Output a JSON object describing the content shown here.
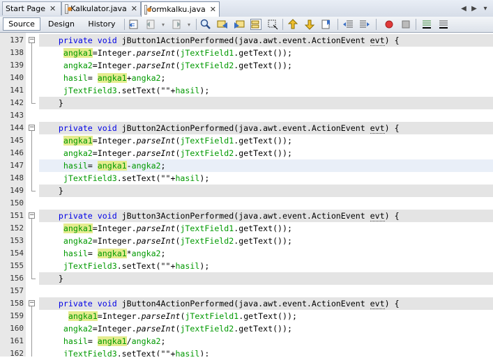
{
  "tabs": [
    {
      "label": "Start Page",
      "close": "✕",
      "active": false
    },
    {
      "label": "Kalkulator.java",
      "close": "✕",
      "active": false
    },
    {
      "label": "formkalku.java",
      "close": "✕",
      "active": true
    }
  ],
  "tab_nav": {
    "left": "◀",
    "right": "▶",
    "menu": "▾"
  },
  "view_tabs": [
    "Source",
    "Design",
    "History"
  ],
  "toolbar_icons": [
    "last-edit-icon",
    "back-icon",
    "forward-icon",
    "find-icon",
    "find-previous-icon",
    "find-next-icon",
    "toggle-highlight-icon",
    "toggle-rect-select-icon",
    "previous-bookmark-icon",
    "next-bookmark-icon",
    "toggle-bookmark-icon",
    "shift-left-icon",
    "shift-right-icon",
    "record-macro-icon",
    "stop-macro-icon",
    "comment-icon"
  ],
  "lines": [
    {
      "n": "137",
      "marker": "fold-open",
      "bg": "method",
      "parts": [
        {
          "t": "    "
        },
        {
          "t": "private",
          "c": "kw"
        },
        {
          "t": " "
        },
        {
          "t": "void",
          "c": "kw"
        },
        {
          "t": " jButton1ActionPerformed(java.awt.event.ActionEvent "
        },
        {
          "t": "evt",
          "c": "sq"
        },
        {
          "t": ") {"
        }
      ]
    },
    {
      "n": "138",
      "marker": "",
      "bg": "",
      "parts": [
        {
          "t": "     "
        },
        {
          "t": "angka1",
          "c": "fld hl"
        },
        {
          "t": "=Integer."
        },
        {
          "t": "parseInt",
          "c": "it"
        },
        {
          "t": "("
        },
        {
          "t": "jTextField1",
          "c": "fld"
        },
        {
          "t": ".getText());"
        }
      ]
    },
    {
      "n": "139",
      "marker": "",
      "bg": "",
      "parts": [
        {
          "t": "     "
        },
        {
          "t": "angka2",
          "c": "fld"
        },
        {
          "t": "=Integer."
        },
        {
          "t": "parseInt",
          "c": "it"
        },
        {
          "t": "("
        },
        {
          "t": "jTextField2",
          "c": "fld"
        },
        {
          "t": ".getText());"
        }
      ]
    },
    {
      "n": "140",
      "marker": "",
      "bg": "",
      "parts": [
        {
          "t": "     "
        },
        {
          "t": "hasil",
          "c": "fld"
        },
        {
          "t": "= "
        },
        {
          "t": "angka1",
          "c": "fld hl"
        },
        {
          "t": "+"
        },
        {
          "t": "angka2",
          "c": "fld"
        },
        {
          "t": ";"
        }
      ]
    },
    {
      "n": "141",
      "marker": "",
      "bg": "",
      "parts": [
        {
          "t": "     "
        },
        {
          "t": "jTextField3",
          "c": "fld"
        },
        {
          "t": ".setText(\"\"+"
        },
        {
          "t": "hasil",
          "c": "fld"
        },
        {
          "t": ");"
        }
      ]
    },
    {
      "n": "142",
      "marker": "fold-end",
      "bg": "method",
      "parts": [
        {
          "t": "    }"
        }
      ]
    },
    {
      "n": "143",
      "marker": "",
      "bg": "",
      "parts": [
        {
          "t": ""
        }
      ]
    },
    {
      "n": "144",
      "marker": "fold-open",
      "bg": "method",
      "parts": [
        {
          "t": "    "
        },
        {
          "t": "private",
          "c": "kw"
        },
        {
          "t": " "
        },
        {
          "t": "void",
          "c": "kw"
        },
        {
          "t": " jButton2ActionPerformed(java.awt.event.ActionEvent "
        },
        {
          "t": "evt",
          "c": "sq"
        },
        {
          "t": ") {"
        }
      ]
    },
    {
      "n": "145",
      "marker": "",
      "bg": "",
      "parts": [
        {
          "t": "     "
        },
        {
          "t": "angka1",
          "c": "fld hl"
        },
        {
          "t": "=Integer."
        },
        {
          "t": "parseInt",
          "c": "it"
        },
        {
          "t": "("
        },
        {
          "t": "jTextField1",
          "c": "fld"
        },
        {
          "t": ".getText());"
        }
      ]
    },
    {
      "n": "146",
      "marker": "",
      "bg": "",
      "parts": [
        {
          "t": "     "
        },
        {
          "t": "angka2",
          "c": "fld"
        },
        {
          "t": "=Integer."
        },
        {
          "t": "parseInt",
          "c": "it"
        },
        {
          "t": "("
        },
        {
          "t": "jTextField2",
          "c": "fld"
        },
        {
          "t": ".getText());"
        }
      ]
    },
    {
      "n": "147",
      "marker": "",
      "bg": "current",
      "parts": [
        {
          "t": "     "
        },
        {
          "t": "hasil",
          "c": "fld"
        },
        {
          "t": "= "
        },
        {
          "t": "angka1",
          "c": "fld hl"
        },
        {
          "t": "-"
        },
        {
          "t": "angka2",
          "c": "fld"
        },
        {
          "t": ";"
        }
      ]
    },
    {
      "n": "148",
      "marker": "",
      "bg": "",
      "parts": [
        {
          "t": "     "
        },
        {
          "t": "jTextField3",
          "c": "fld"
        },
        {
          "t": ".setText(\"\"+"
        },
        {
          "t": "hasil",
          "c": "fld"
        },
        {
          "t": ");"
        }
      ]
    },
    {
      "n": "149",
      "marker": "fold-end",
      "bg": "method",
      "parts": [
        {
          "t": "    }"
        }
      ]
    },
    {
      "n": "150",
      "marker": "",
      "bg": "",
      "parts": [
        {
          "t": ""
        }
      ]
    },
    {
      "n": "151",
      "marker": "fold-open",
      "bg": "method",
      "parts": [
        {
          "t": "    "
        },
        {
          "t": "private",
          "c": "kw"
        },
        {
          "t": " "
        },
        {
          "t": "void",
          "c": "kw"
        },
        {
          "t": " jButton3ActionPerformed(java.awt.event.ActionEvent "
        },
        {
          "t": "evt",
          "c": "sq"
        },
        {
          "t": ") {"
        }
      ]
    },
    {
      "n": "152",
      "marker": "",
      "bg": "",
      "parts": [
        {
          "t": "     "
        },
        {
          "t": "angka1",
          "c": "fld hl"
        },
        {
          "t": "=Integer."
        },
        {
          "t": "parseInt",
          "c": "it"
        },
        {
          "t": "("
        },
        {
          "t": "jTextField1",
          "c": "fld"
        },
        {
          "t": ".getText());"
        }
      ]
    },
    {
      "n": "153",
      "marker": "",
      "bg": "",
      "parts": [
        {
          "t": "     "
        },
        {
          "t": "angka2",
          "c": "fld"
        },
        {
          "t": "=Integer."
        },
        {
          "t": "parseInt",
          "c": "it"
        },
        {
          "t": "("
        },
        {
          "t": "jTextField2",
          "c": "fld"
        },
        {
          "t": ".getText());"
        }
      ]
    },
    {
      "n": "154",
      "marker": "",
      "bg": "",
      "parts": [
        {
          "t": "     "
        },
        {
          "t": "hasil",
          "c": "fld"
        },
        {
          "t": "= "
        },
        {
          "t": "angka1",
          "c": "fld hl"
        },
        {
          "t": "*"
        },
        {
          "t": "angka2",
          "c": "fld"
        },
        {
          "t": ";"
        }
      ]
    },
    {
      "n": "155",
      "marker": "",
      "bg": "",
      "parts": [
        {
          "t": "     "
        },
        {
          "t": "jTextField3",
          "c": "fld"
        },
        {
          "t": ".setText(\"\"+"
        },
        {
          "t": "hasil",
          "c": "fld"
        },
        {
          "t": ");"
        }
      ]
    },
    {
      "n": "156",
      "marker": "fold-end",
      "bg": "method",
      "parts": [
        {
          "t": "    }"
        }
      ]
    },
    {
      "n": "157",
      "marker": "",
      "bg": "",
      "parts": [
        {
          "t": ""
        }
      ]
    },
    {
      "n": "158",
      "marker": "fold-open",
      "bg": "method",
      "parts": [
        {
          "t": "    "
        },
        {
          "t": "private",
          "c": "kw"
        },
        {
          "t": " "
        },
        {
          "t": "void",
          "c": "kw"
        },
        {
          "t": " jButton4ActionPerformed(java.awt.event.ActionEvent "
        },
        {
          "t": "evt",
          "c": "sq"
        },
        {
          "t": ") {"
        }
      ]
    },
    {
      "n": "159",
      "marker": "",
      "bg": "",
      "parts": [
        {
          "t": "      "
        },
        {
          "t": "angka1",
          "c": "fld hl"
        },
        {
          "t": "=Integer."
        },
        {
          "t": "parseInt",
          "c": "it"
        },
        {
          "t": "("
        },
        {
          "t": "jTextField1",
          "c": "fld"
        },
        {
          "t": ".getText());"
        }
      ]
    },
    {
      "n": "160",
      "marker": "",
      "bg": "",
      "parts": [
        {
          "t": "     "
        },
        {
          "t": "angka2",
          "c": "fld"
        },
        {
          "t": "=Integer."
        },
        {
          "t": "parseInt",
          "c": "it"
        },
        {
          "t": "("
        },
        {
          "t": "jTextField2",
          "c": "fld"
        },
        {
          "t": ".getText());"
        }
      ]
    },
    {
      "n": "161",
      "marker": "",
      "bg": "",
      "parts": [
        {
          "t": "     "
        },
        {
          "t": "hasil",
          "c": "fld"
        },
        {
          "t": "= "
        },
        {
          "t": "angka1",
          "c": "fld hl"
        },
        {
          "t": "/"
        },
        {
          "t": "angka2",
          "c": "fld"
        },
        {
          "t": ";"
        }
      ]
    },
    {
      "n": "162",
      "marker": "",
      "bg": "",
      "parts": [
        {
          "t": "     "
        },
        {
          "t": "jTextField3",
          "c": "fld"
        },
        {
          "t": ".setText(\"\"+"
        },
        {
          "t": "hasil",
          "c": "fld"
        },
        {
          "t": ");"
        }
      ]
    }
  ]
}
